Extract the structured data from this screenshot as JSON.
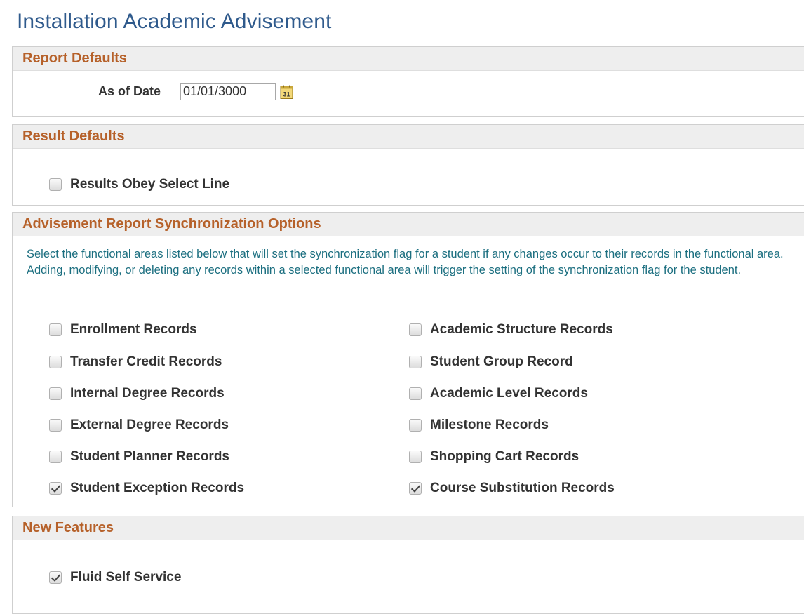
{
  "page": {
    "title": "Installation Academic Advisement"
  },
  "report_defaults": {
    "header": "Report Defaults",
    "as_of_date_label": "As of Date",
    "as_of_date_value": "01/01/3000"
  },
  "result_defaults": {
    "header": "Result Defaults",
    "results_obey_select_line": {
      "label": "Results Obey Select Line",
      "checked": false
    }
  },
  "sync_options": {
    "header": "Advisement Report Synchronization Options",
    "description": "Select the functional areas listed below that will set the synchronization flag for a student if any changes occur to their records in the functional area. Adding, modifying, or deleting any records within a selected functional area will trigger the setting of the synchronization flag for the student.",
    "left_column": [
      {
        "label": "Enrollment Records",
        "checked": false
      },
      {
        "label": "Transfer Credit Records",
        "checked": false
      },
      {
        "label": "Internal Degree Records",
        "checked": false
      },
      {
        "label": "External Degree Records",
        "checked": false
      },
      {
        "label": "Student Planner Records",
        "checked": false
      },
      {
        "label": "Student Exception Records",
        "checked": true
      }
    ],
    "right_column": [
      {
        "label": "Academic Structure Records",
        "checked": false
      },
      {
        "label": "Student Group Record",
        "checked": false
      },
      {
        "label": "Academic Level Records",
        "checked": false
      },
      {
        "label": "Milestone Records",
        "checked": false
      },
      {
        "label": "Shopping Cart Records",
        "checked": false
      },
      {
        "label": "Course Substitution Records",
        "checked": true
      }
    ]
  },
  "new_features": {
    "header": "New Features",
    "fluid_self_service": {
      "label": "Fluid Self Service",
      "checked": true
    }
  },
  "colors": {
    "title": "#2f5a8c",
    "section_header_text": "#b6612a",
    "section_header_bg": "#eeeeee",
    "description_text": "#1c6f80"
  },
  "icons": {
    "calendar": "calendar-icon",
    "checkbox": "checkbox"
  }
}
